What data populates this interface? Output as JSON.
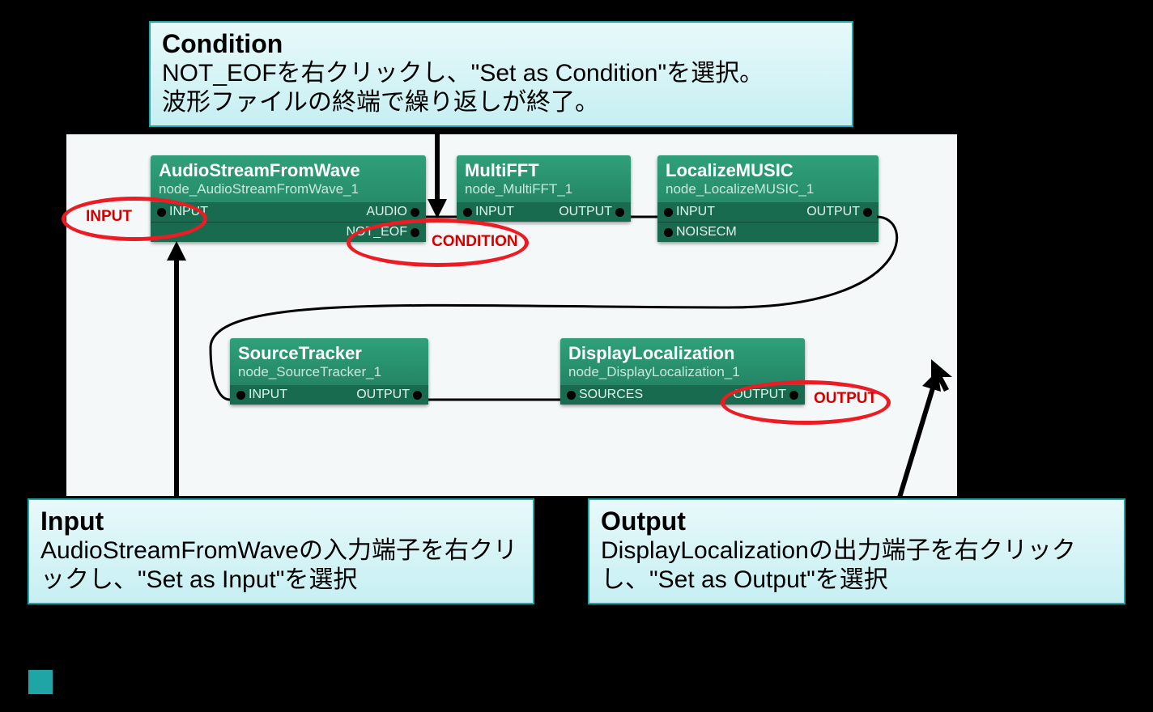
{
  "callouts": {
    "condition": {
      "title": "Condition",
      "body1": "NOT_EOFを右クリックし、\"Set as Condition\"を選択。",
      "body2": "波形ファイルの終端で繰り返しが終了。"
    },
    "input": {
      "title": "Input",
      "body": "AudioStreamFromWaveの入力端子を右クリックし、\"Set as Input\"を選択"
    },
    "output": {
      "title": "Output",
      "body": "DisplayLocalizationの出力端子を右クリックし、\"Set as Output\"を選択"
    }
  },
  "ext_labels": {
    "input": "INPUT",
    "condition": "CONDITION",
    "output": "OUTPUT"
  },
  "nodes": {
    "asfw": {
      "title": "AudioStreamFromWave",
      "sub": "node_AudioStreamFromWave_1",
      "in1": "INPUT",
      "out1": "AUDIO",
      "out2": "NOT_EOF"
    },
    "mfft": {
      "title": "MultiFFT",
      "sub": "node_MultiFFT_1",
      "in1": "INPUT",
      "out1": "OUTPUT"
    },
    "lmusic": {
      "title": "LocalizeMUSIC",
      "sub": "node_LocalizeMUSIC_1",
      "in1": "INPUT",
      "in2": "NOISECM",
      "out1": "OUTPUT"
    },
    "stracker": {
      "title": "SourceTracker",
      "sub": "node_SourceTracker_1",
      "in1": "INPUT",
      "out1": "OUTPUT"
    },
    "dloc": {
      "title": "DisplayLocalization",
      "sub": "node_DisplayLocalization_1",
      "in1": "SOURCES",
      "out1": "OUTPUT"
    }
  }
}
